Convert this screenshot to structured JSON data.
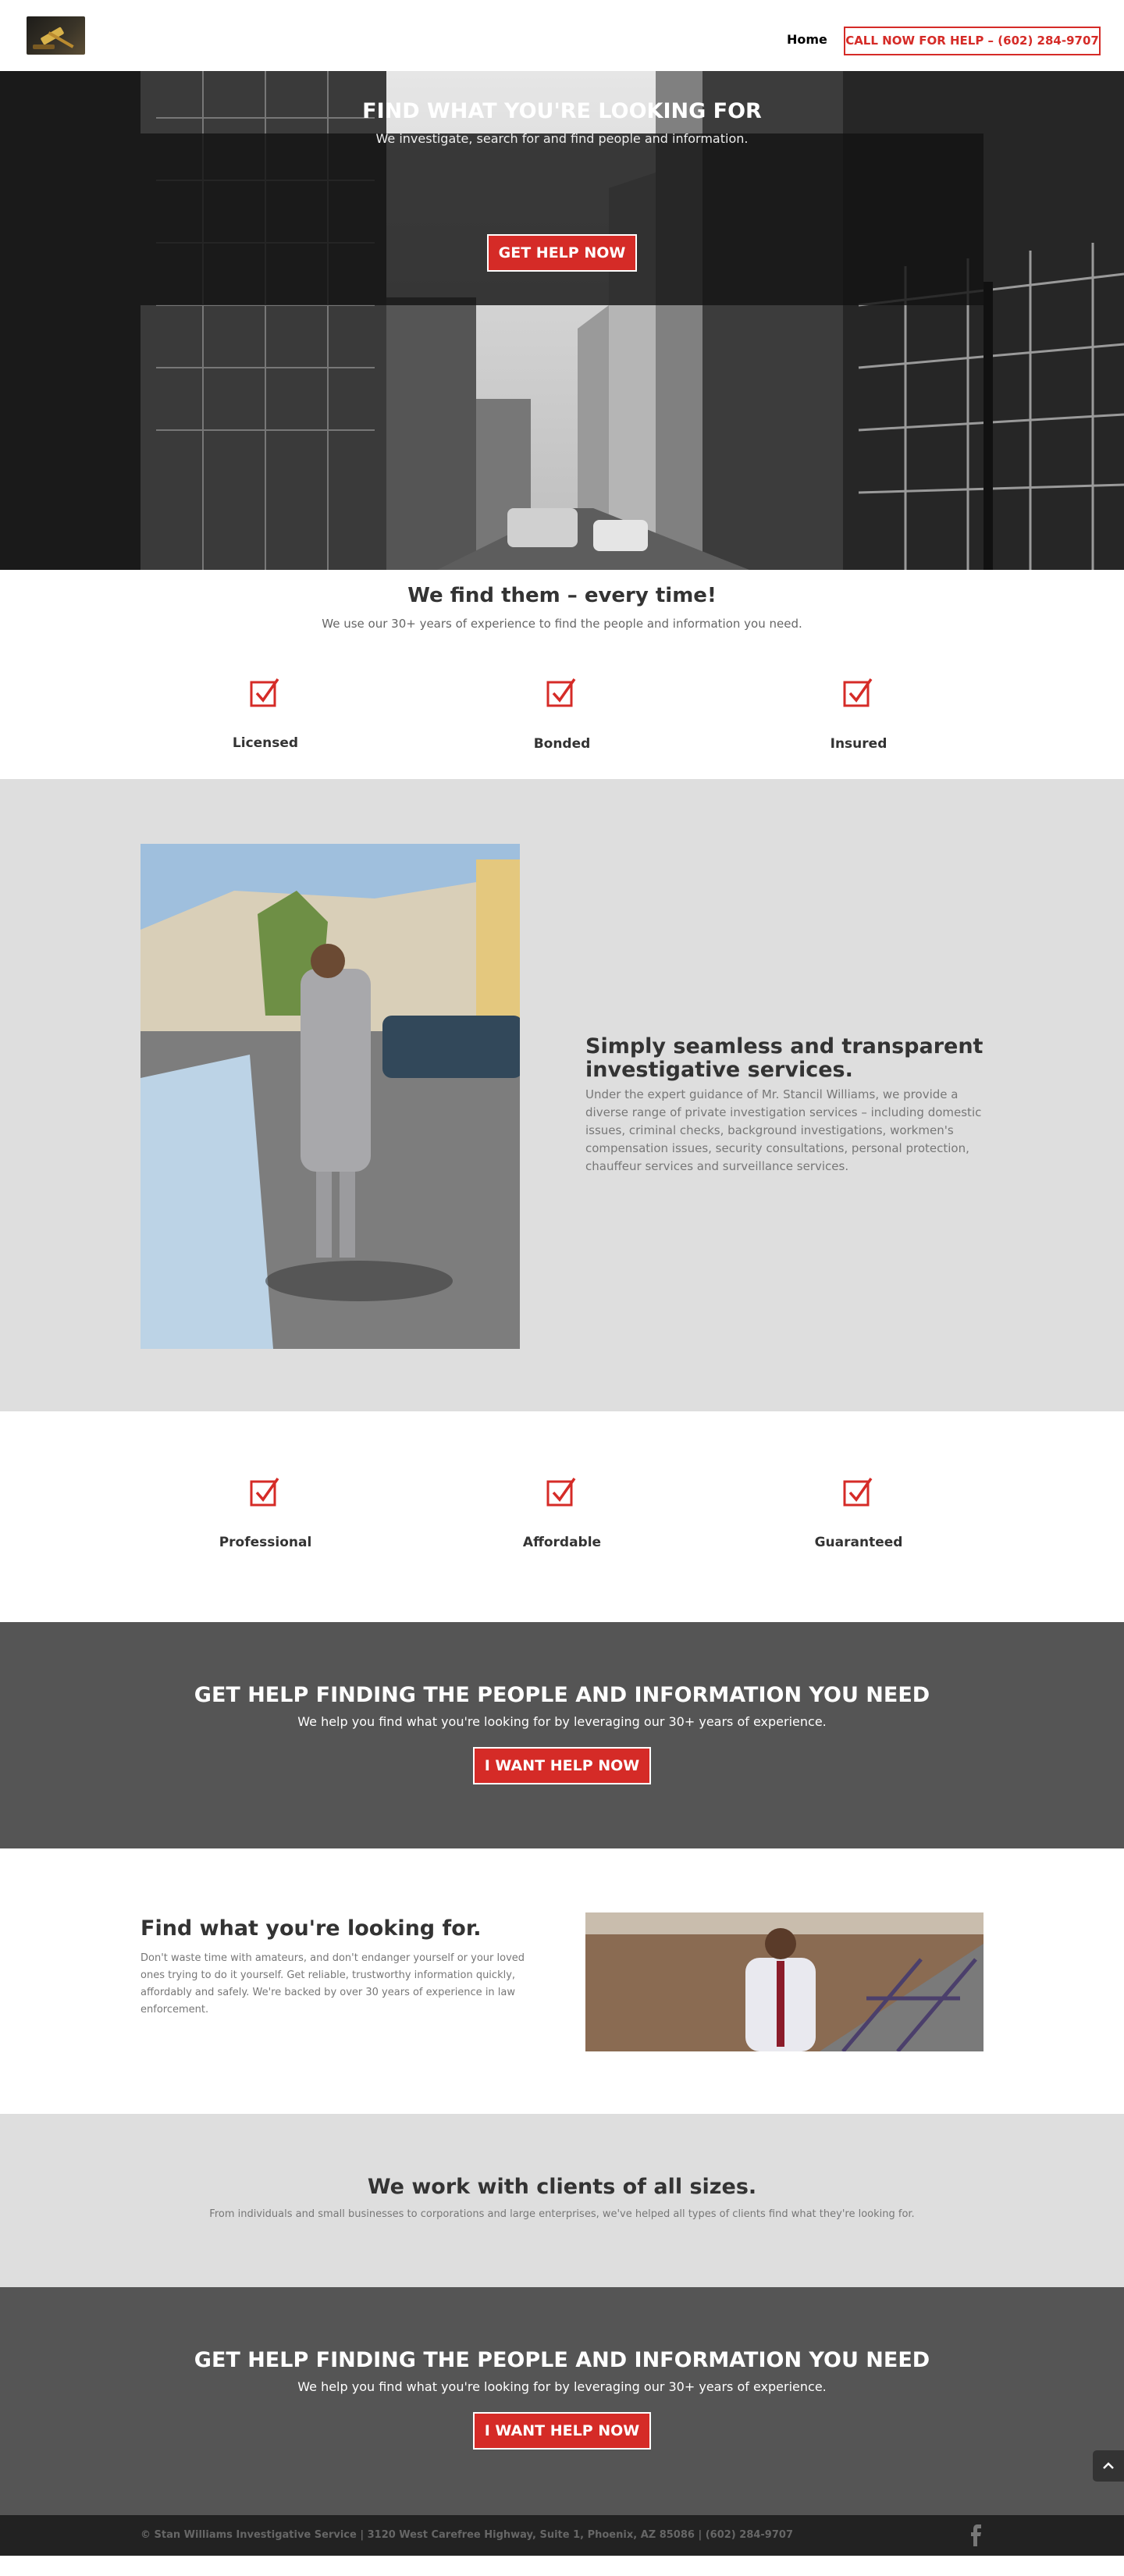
{
  "header": {
    "nav_home": "Home",
    "cta": "CALL NOW FOR HELP – (602) 284-9707"
  },
  "hero": {
    "title": "FIND WHAT YOU'RE LOOKING FOR",
    "subtitle": "We investigate, search for and find people and information.",
    "button": "GET HELP NOW"
  },
  "intro": {
    "title": "We find them – every time!",
    "subtitle": "We use our 30+ years of experience to find the people and information you need."
  },
  "features_top": [
    "Licensed",
    "Bonded",
    "Insured"
  ],
  "seamless": {
    "title": "Simply seamless and transparent investigative services.",
    "body": "Under the expert guidance of Mr. Stancil Williams, we provide a diverse range of private investigation services – including domestic issues, criminal checks, background investigations, workmen's compensation issues, security consultations, personal protection, chauffeur services and surveillance services."
  },
  "features_bottom": [
    "Professional",
    "Affordable",
    "Guaranteed"
  ],
  "cta1": {
    "title": "GET HELP FINDING THE PEOPLE AND INFORMATION YOU NEED",
    "subtitle": "We help you find what you're looking for by leveraging our 30+ years of experience.",
    "button": "I WANT HELP NOW"
  },
  "looking": {
    "title": "Find what you're looking for.",
    "body": "Don't waste time with amateurs, and don't endanger yourself or your loved ones trying to do it yourself.  Get reliable, trustworthy information quickly, affordably and safely.  We're backed by over 30 years of experience in law enforcement."
  },
  "clients": {
    "title": "We work with clients of all sizes.",
    "subtitle": "From individuals and small businesses to corporations and large enterprises, we've helped all types of clients find what they're looking for."
  },
  "cta2": {
    "title": "GET HELP FINDING THE PEOPLE AND INFORMATION YOU NEED",
    "subtitle": "We help you find what you're looking for by leveraging our 30+ years of experience.",
    "button": "I WANT HELP NOW"
  },
  "footer": {
    "text": "© Stan Williams Investigative Service | 3120 West Carefree Highway, Suite 1, Phoenix, AZ 85086 | (602) 284-9707"
  },
  "icons": {
    "feature": "checkbox-checked-icon",
    "social": "facebook-icon",
    "scroll": "chevron-up-icon"
  },
  "colors": {
    "accent": "#d52b27",
    "dark_section": "#555555",
    "gray_section": "#dedede",
    "footer": "#222222"
  }
}
